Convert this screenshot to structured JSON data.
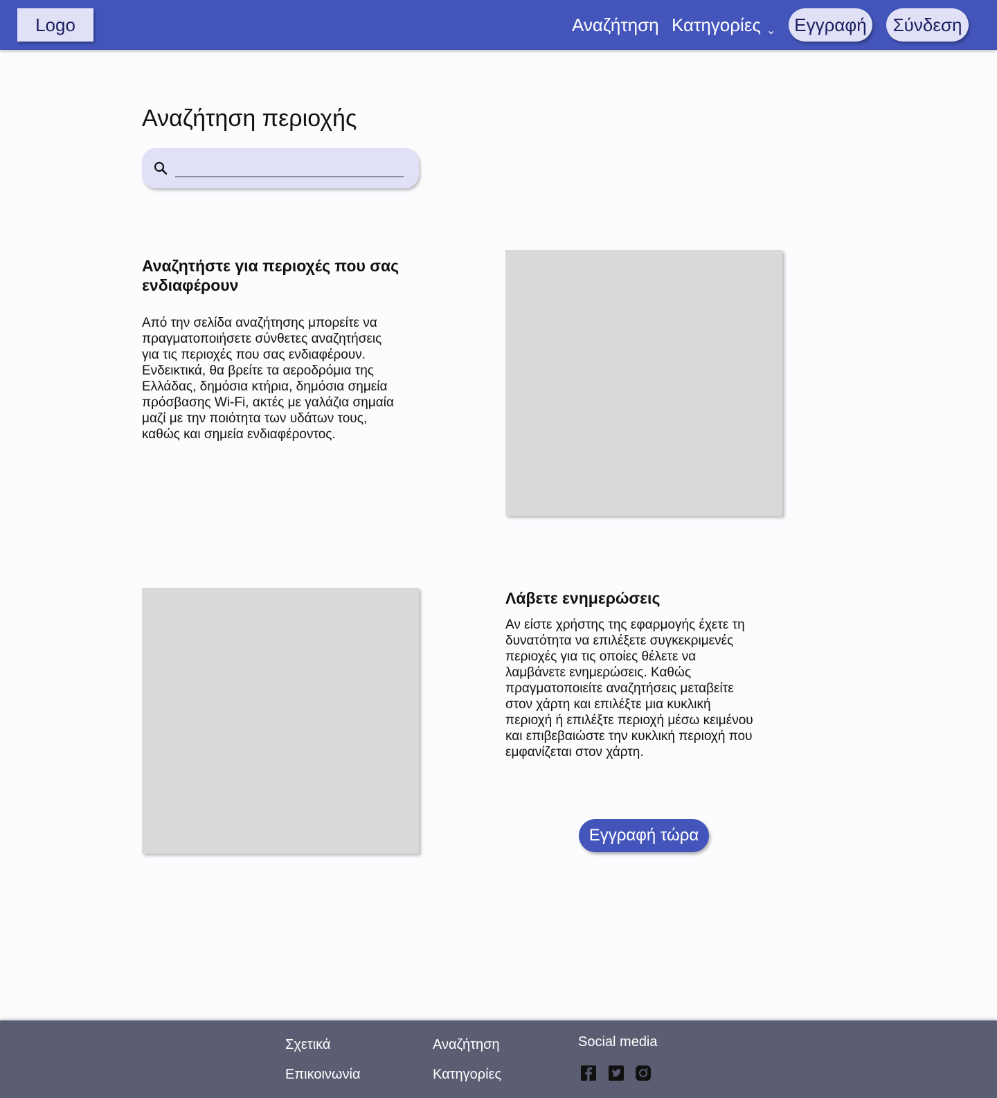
{
  "header": {
    "logo": "Logo",
    "nav": {
      "search": "Αναζήτηση",
      "categories": "Κατηγορίες",
      "categories_chevron": "⌄"
    },
    "register": "Εγγραφή",
    "login": "Σύνδεση"
  },
  "search_section": {
    "title": "Αναζήτηση περιοχής",
    "input_value": "",
    "input_placeholder": ""
  },
  "feature_search": {
    "heading_line1": "Αναζητήστε για περιοχές που σας",
    "heading_line2": "ενδιαφέρουν",
    "text_lines": [
      "Από την σελίδα αναζήτησης μπορείτε να",
      "πραγματοποιήσετε σύνθετες αναζητήσεις",
      "για τις περιοχές που σας ενδιαφέρουν.",
      "Ενδεικτικά, θα βρείτε τα αεροδρόμια της",
      "Ελλάδας, δημόσια κτήρια, δημόσια σημεία",
      "πρόσβασης Wi-Fi, ακτές με γαλάζια σημαία",
      "μαζί με την ποιότητα των υδάτων τους,",
      "καθώς και σημεία ενδιαφέροντος."
    ]
  },
  "feature_updates": {
    "heading": "Λάβετε ενημερώσεις",
    "text_lines": [
      "Αν είστε χρήστης της εφαρμογής έχετε τη",
      "δυνατότητα να επιλέξετε συγκεκριμενές",
      "περιοχές για τις οποίες θέλετε να",
      "λαμβάνετε ενημερώσεις. Καθώς",
      "πραγματοποιείτε αναζητήσεις μεταβείτε",
      "στον χάρτη και επιλέξτε μια κυκλική",
      "περιοχή ή επιλέξτε περιοχή μέσω κειμένου",
      "και επιβεβαιώστε την κυκλική περιοχή που",
      "εμφανίζεται στον χάρτη."
    ],
    "cta": "Εγγραφή τώρα"
  },
  "footer": {
    "about": "Σχετικά",
    "contact": "Επικοινωνία",
    "search": "Αναζήτηση",
    "categories": "Κατηγορίες",
    "social_title": "Social media",
    "social_icons": [
      "facebook-icon",
      "twitter-icon",
      "instagram-icon"
    ]
  },
  "colors": {
    "header_bg": "#4355bb",
    "pill_bg": "#e0e1f7",
    "placeholder_bg": "#d9d9d9",
    "footer_bg": "#5b5d73",
    "page_bg": "#fcfbfe"
  }
}
